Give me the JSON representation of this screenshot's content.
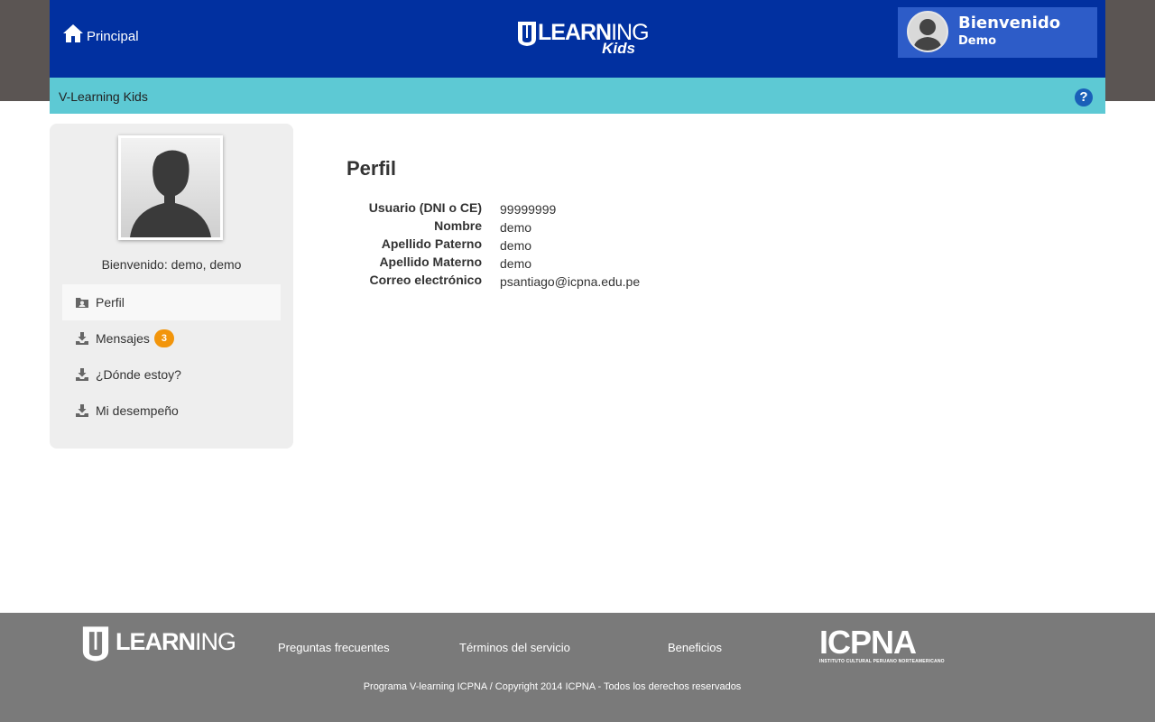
{
  "header": {
    "home_label": "Principal",
    "logo": {
      "brand_bold": "LEARN",
      "brand_thin": "ING",
      "sub": "Kids"
    },
    "user": {
      "welcome": "Bienvenido",
      "name": "Demo"
    },
    "accent_color": "#0130a0"
  },
  "subbar": {
    "title": "V-Learning Kids",
    "help_icon": "question-circle-icon",
    "color": "#5dc9d4"
  },
  "sidebar": {
    "welcome": "Bienvenido: demo, demo",
    "items": [
      {
        "label": "Perfil",
        "icon": "profile-folder-icon",
        "active": true
      },
      {
        "label": "Mensajes",
        "icon": "inbox-icon",
        "badge": "3"
      },
      {
        "label": "¿Dónde estoy?",
        "icon": "inbox-icon"
      },
      {
        "label": "Mi desempeño",
        "icon": "inbox-icon"
      }
    ]
  },
  "profile": {
    "title": "Perfil",
    "fields": [
      {
        "label": "Usuario (DNI o CE)",
        "value": "99999999"
      },
      {
        "label": "Nombre",
        "value": "demo"
      },
      {
        "label": "Apellido Paterno",
        "value": "demo"
      },
      {
        "label": "Apellido Materno",
        "value": "demo"
      },
      {
        "label": "Correo electrónico",
        "value": "psantiago@icpna.edu.pe"
      }
    ]
  },
  "footer": {
    "logo_bold": "LEARN",
    "logo_thin": "ING",
    "links": [
      "Preguntas frecuentes",
      "Términos del servicio",
      "Beneficios"
    ],
    "icpna": "ICPNA",
    "icpna_sub": "INSTITUTO CULTURAL PERUANO NORTEAMERICANO",
    "copyright": "Programa V-learning ICPNA / Copyright 2014 ICPNA - Todos los derechos reservados"
  }
}
